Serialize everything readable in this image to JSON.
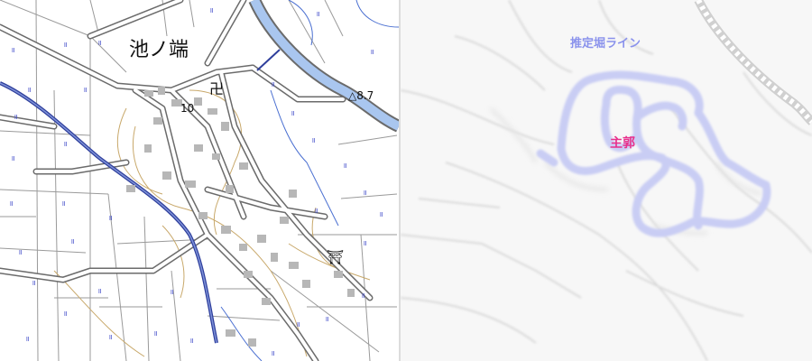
{
  "left_map": {
    "place_name": "池ノ端",
    "elevation_point": "10",
    "triangulation_point": "△8.7",
    "temple_symbol": "卍",
    "shrine_symbol": "⛩",
    "paddy_symbol": "॥"
  },
  "right_map": {
    "moat_label": "推定堀ライン",
    "main_bailey_label": "主郭"
  },
  "colors": {
    "road": "#6b6b6b",
    "river": "#2f3f9c",
    "canal_fill": "#a9c6ef",
    "contour": "#c8a86a",
    "building": "#b7b7b7",
    "paddy_symbol": "#3a45c8",
    "moat_line": "#c9cdf4",
    "main_bailey_label": "#e8308c",
    "moat_label": "#8a92ec"
  }
}
